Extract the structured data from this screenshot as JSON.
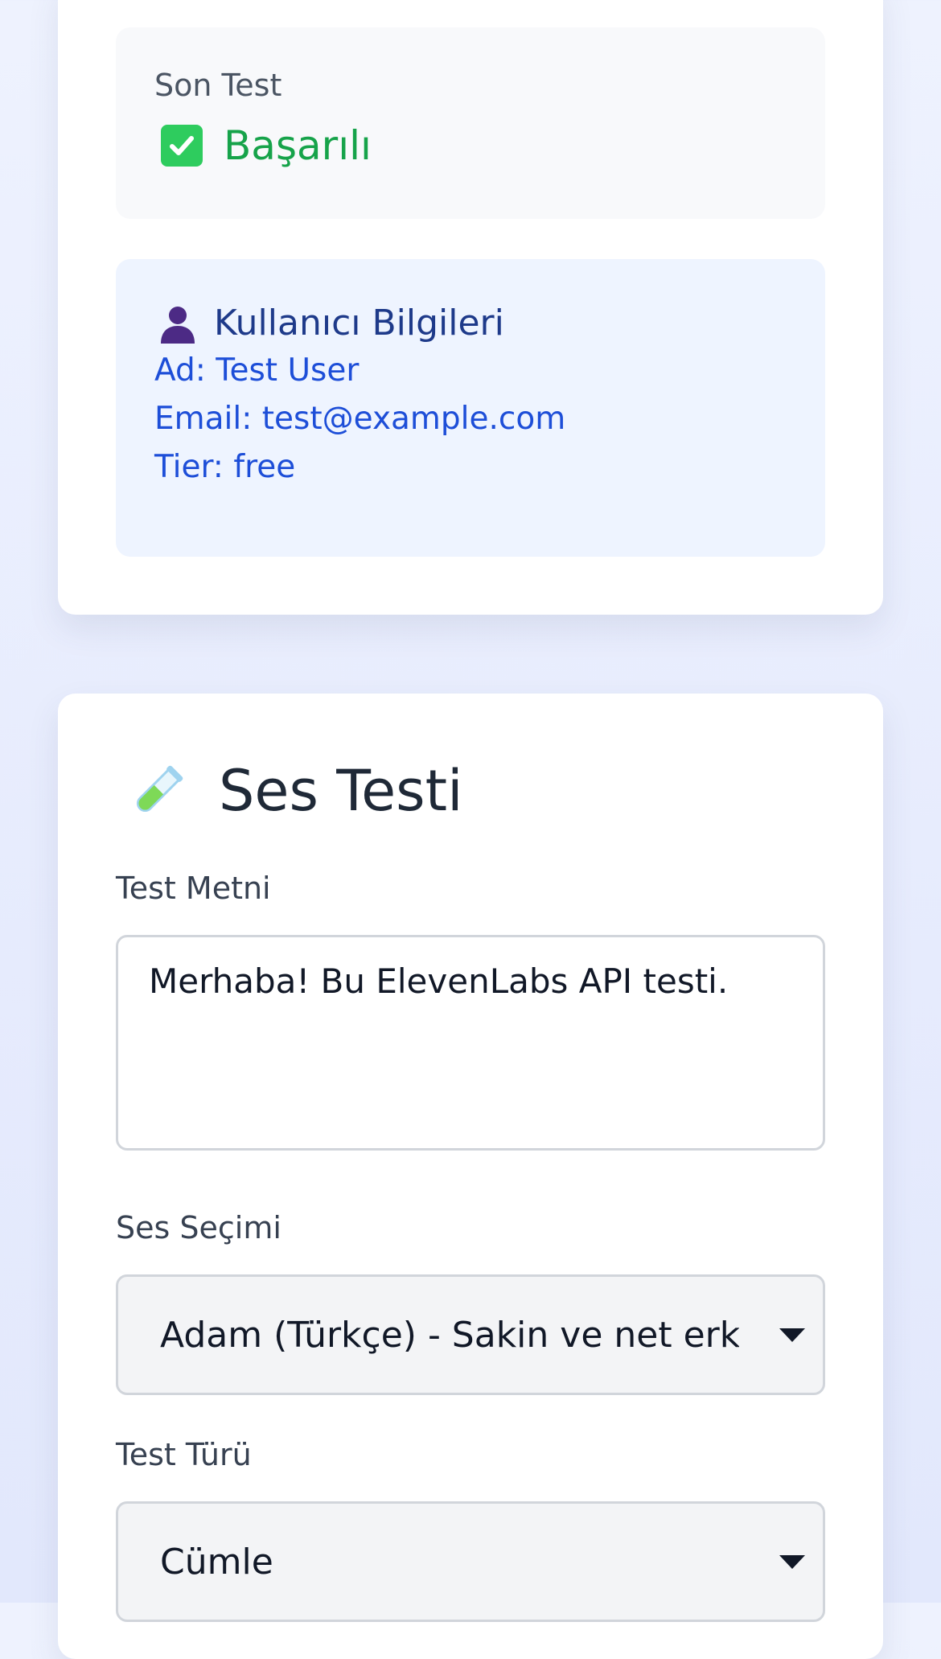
{
  "status_panel": {
    "label": "Son Test",
    "icon": "check-mark-icon",
    "value": "Başarılı"
  },
  "user_panel": {
    "icon": "user-silhouette-icon",
    "title": "Kullanıcı Bilgileri",
    "name_line": "Ad: Test User",
    "email_line": "Email: test@example.com",
    "tier_line": "Tier: free"
  },
  "voice_test": {
    "icon": "test-tube-icon",
    "title": "Ses Testi",
    "text_label": "Test Metni",
    "text_value": "Merhaba! Bu ElevenLabs API testi.",
    "voice_label": "Ses Seçimi",
    "voice_value": "Adam (Türkçe) - Sakin ve net erke",
    "type_label": "Test Türü",
    "type_value": "Cümle"
  },
  "colors": {
    "success": "#16a34a",
    "user_text": "#1d4ed8",
    "user_panel_bg": "#eef4ff"
  }
}
